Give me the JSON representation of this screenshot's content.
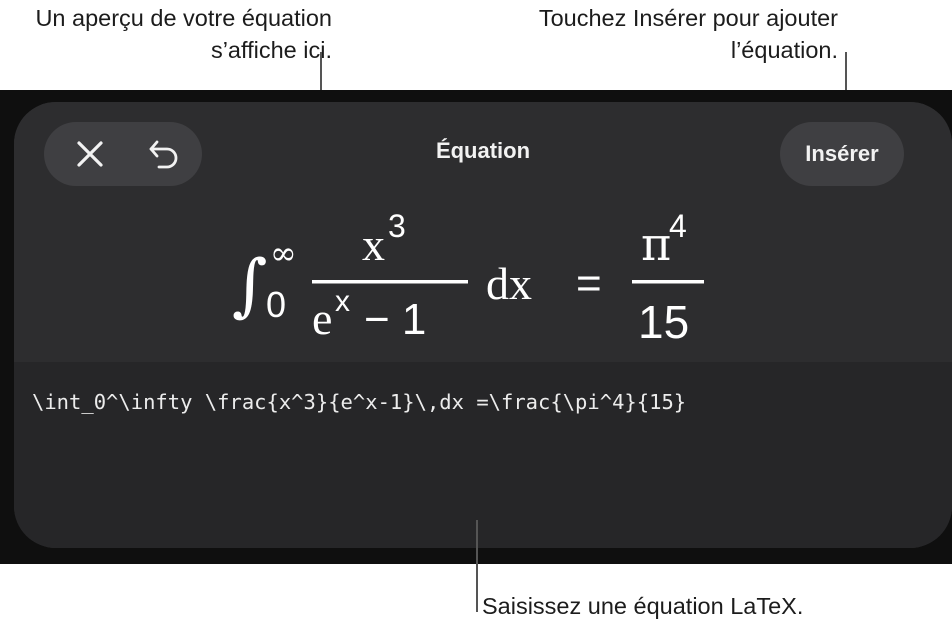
{
  "annotations": {
    "preview": "Un aperçu de votre équation s’affiche ici.",
    "insert": "Touchez Insérer pour ajouter l’équation.",
    "latex": "Saisissez une équation LaTeX."
  },
  "sheet": {
    "title": "Équation",
    "insert_label": "Insérer",
    "close_icon": "close-icon",
    "undo_icon": "undo-icon"
  },
  "equation": {
    "integral": "∫",
    "upper_limit": "∞",
    "lower_limit": "0",
    "numerator": "x",
    "numerator_exp": "3",
    "denominator_base": "e",
    "denominator_exp": "x",
    "denominator_rest": "− 1",
    "differential": "dx",
    "equals": "=",
    "rhs_numerator": "π",
    "rhs_numerator_exp": "4",
    "rhs_denominator": "15"
  },
  "editor": {
    "latex": "\\int_0^\\infty \\frac{x^3}{e^x-1}\\,dx =\\frac{\\pi^4}{15}"
  }
}
